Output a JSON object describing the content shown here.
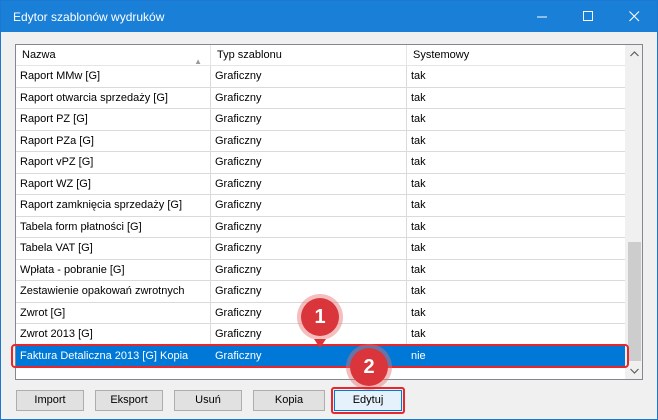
{
  "window": {
    "title": "Edytor szablonów wydruków",
    "controls": [
      "minimize-icon",
      "maximize-icon",
      "close-icon"
    ]
  },
  "table": {
    "columns": [
      "Nazwa",
      "Typ szablonu",
      "Systemowy"
    ],
    "sort_column": "Nazwa",
    "sort_direction": "ascending",
    "rows": [
      {
        "name": "Raport MMw [G]",
        "type": "Graficzny",
        "system": "tak"
      },
      {
        "name": "Raport otwarcia sprzedaży [G]",
        "type": "Graficzny",
        "system": "tak"
      },
      {
        "name": "Raport PZ [G]",
        "type": "Graficzny",
        "system": "tak"
      },
      {
        "name": "Raport PZa [G]",
        "type": "Graficzny",
        "system": "tak"
      },
      {
        "name": "Raport vPZ [G]",
        "type": "Graficzny",
        "system": "tak"
      },
      {
        "name": "Raport WZ [G]",
        "type": "Graficzny",
        "system": "tak"
      },
      {
        "name": "Raport zamknięcia sprzedaży [G]",
        "type": "Graficzny",
        "system": "tak"
      },
      {
        "name": "Tabela form płatności [G]",
        "type": "Graficzny",
        "system": "tak"
      },
      {
        "name": "Tabela VAT [G]",
        "type": "Graficzny",
        "system": "tak"
      },
      {
        "name": "Wpłata - pobranie [G]",
        "type": "Graficzny",
        "system": "tak"
      },
      {
        "name": "Zestawienie opakowań zwrotnych",
        "type": "Graficzny",
        "system": "tak"
      },
      {
        "name": "Zwrot [G]",
        "type": "Graficzny",
        "system": "tak"
      },
      {
        "name": "Zwrot 2013 [G]",
        "type": "Graficzny",
        "system": "tak"
      },
      {
        "name": "Faktura Detaliczna 2013 [G] Kopia",
        "type": "Graficzny",
        "system": "nie",
        "selected": true
      }
    ]
  },
  "buttons": {
    "import": "Import",
    "export": "Eksport",
    "delete": "Usuń",
    "copy": "Kopia",
    "edit": "Edytuj"
  },
  "annotations": {
    "step1": "1",
    "step2": "2"
  },
  "colors": {
    "titlebar": "#1a7fd6",
    "selection": "#0078d7",
    "annotation": "#d9353a"
  }
}
